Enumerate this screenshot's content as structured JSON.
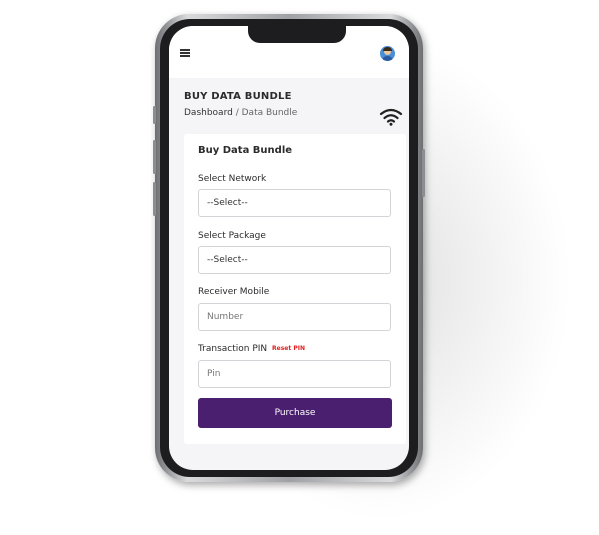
{
  "header": {
    "menu_icon": "hamburger-icon",
    "avatar_icon": "user-avatar-icon"
  },
  "page": {
    "title": "BUY DATA BUNDLE",
    "breadcrumb": {
      "home": "Dashboard",
      "separator": "/",
      "current": "Data Bundle"
    },
    "status_icon": "wifi-icon"
  },
  "form": {
    "title": "Buy Data Bundle",
    "network": {
      "label": "Select Network",
      "value": "--Select--"
    },
    "package": {
      "label": "Select Package",
      "value": "--Select--"
    },
    "receiver": {
      "label": "Receiver Mobile",
      "placeholder": "Number"
    },
    "pin": {
      "label": "Transaction PIN",
      "reset_link": "Reset PIN",
      "placeholder": "Pin"
    },
    "submit_label": "Purchase"
  },
  "colors": {
    "primary": "#4b1f6f",
    "reset_link": "#e0201e",
    "background": "#f5f5f7"
  }
}
